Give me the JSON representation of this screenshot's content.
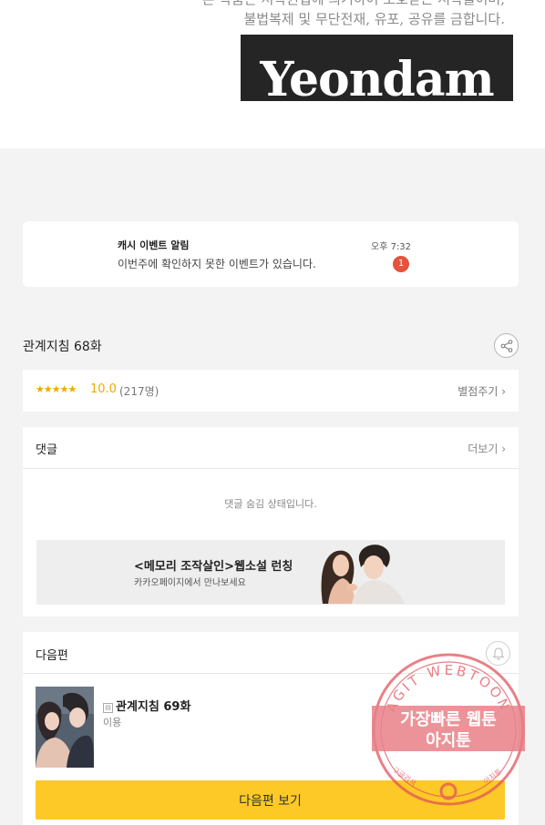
{
  "banner": {
    "copyright_line1": "본 작품은 저작권법에 의거하여 보호받는 저작물이며,",
    "copyright_line2": "불법복제 및 무단전재, 유포, 공유를 금합니다.",
    "logo_text": "Yeondam"
  },
  "notification": {
    "title": "캐시 이벤트 알림",
    "message": "이번주에 확인하지 못한 이벤트가 있습니다.",
    "time": "오후 7:32",
    "badge_count": "1",
    "badge_color": "#e4533a"
  },
  "episode": {
    "title": "관계지침 68화",
    "share_icon": "share-icon"
  },
  "rating": {
    "stars": "★★★★★",
    "score": "10.0",
    "count": "(217명)",
    "rate_label": "별점주기 ›"
  },
  "comments": {
    "header": "댓글",
    "more_label": "더보기 ›",
    "hidden_message": "댓글 숨김 상태입니다.",
    "promo": {
      "title": "<메모리 조작살인>웹소설 런칭",
      "subtitle": "카카오페이지에서 만나보세요"
    }
  },
  "next_episode": {
    "header": "다음편",
    "bell_icon": "bell-icon",
    "episode_title": "관계지침 69화",
    "status": "이용",
    "button_label": "다음편 보기",
    "accent_color": "#fdc927"
  },
  "watermark": {
    "ring_text": "AGIT WEBTOON",
    "line1": "가장빠른 웹툰",
    "line2": "아지툰",
    "bottom_left": "구글검색",
    "bottom_right": "아지툰",
    "color": "#e0505a"
  }
}
